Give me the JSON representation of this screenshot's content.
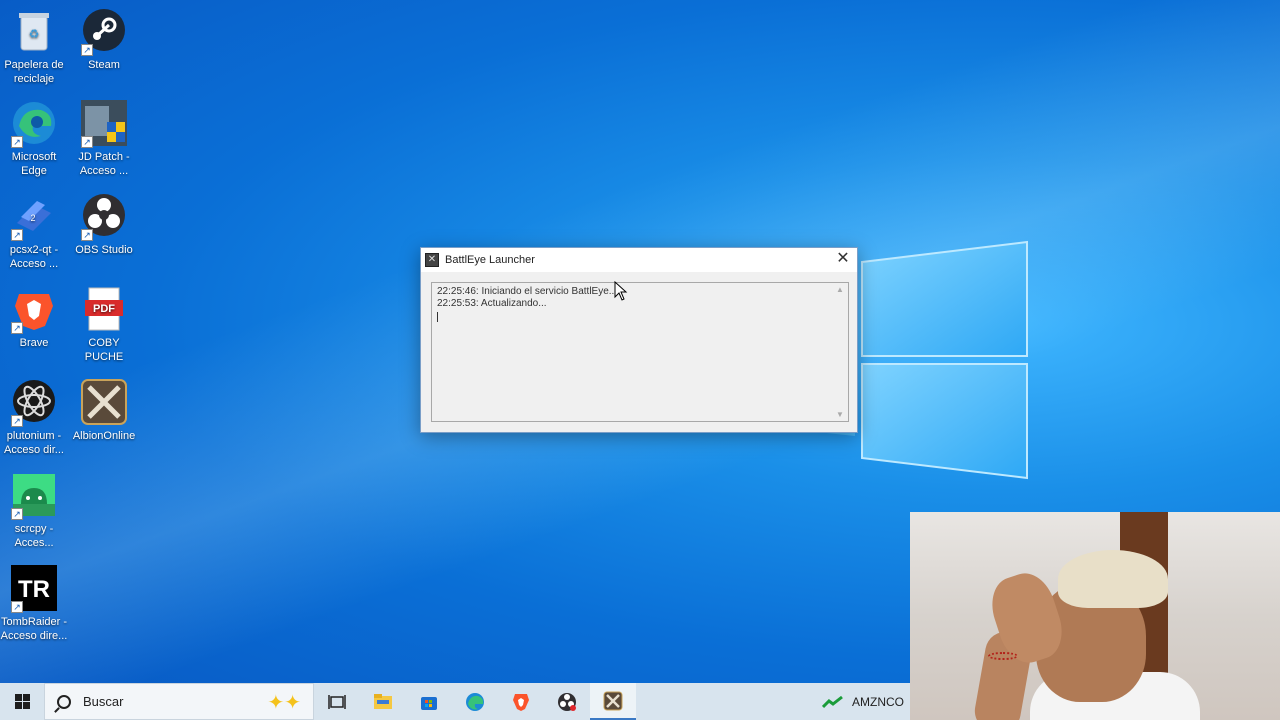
{
  "desktop": {
    "icons": [
      {
        "label": "Papelera de reciclaje",
        "icon": "recycle-bin-icon"
      },
      {
        "label": "Steam",
        "icon": "steam-icon"
      },
      {
        "label": "Microsoft Edge",
        "icon": "edge-icon"
      },
      {
        "label": "JD Patch - Acceso ...",
        "icon": "jd-patch-icon"
      },
      {
        "label": "pcsx2-qt - Acceso ...",
        "icon": "pcsx2-icon"
      },
      {
        "label": "OBS Studio",
        "icon": "obs-icon"
      },
      {
        "label": "Brave",
        "icon": "brave-icon"
      },
      {
        "label": "COBY PUCHE",
        "icon": "pdf-icon"
      },
      {
        "label": "plutonium - Acceso dir...",
        "icon": "plutonium-icon"
      },
      {
        "label": "AlbionOnline",
        "icon": "albion-icon"
      },
      {
        "label": "scrcpy - Acces...",
        "icon": "android-icon"
      },
      {
        "label": "TombRaider - Acceso dire...",
        "icon": "tombraider-icon"
      }
    ],
    "pdf_badge": "PDF",
    "tr_badge": "TR"
  },
  "dialog": {
    "title": "BattlEye Launcher",
    "close_label": "✕",
    "log_lines": [
      "22:25:46: Iniciando el servicio BattlEye...",
      "22:25:53: Actualizando..."
    ]
  },
  "taskbar": {
    "search_placeholder": "Buscar",
    "tray_text": "AMZNCO"
  },
  "colors": {
    "desktop_blue": "#0a6fd6",
    "taskbar_bg": "#d8e4ee"
  }
}
